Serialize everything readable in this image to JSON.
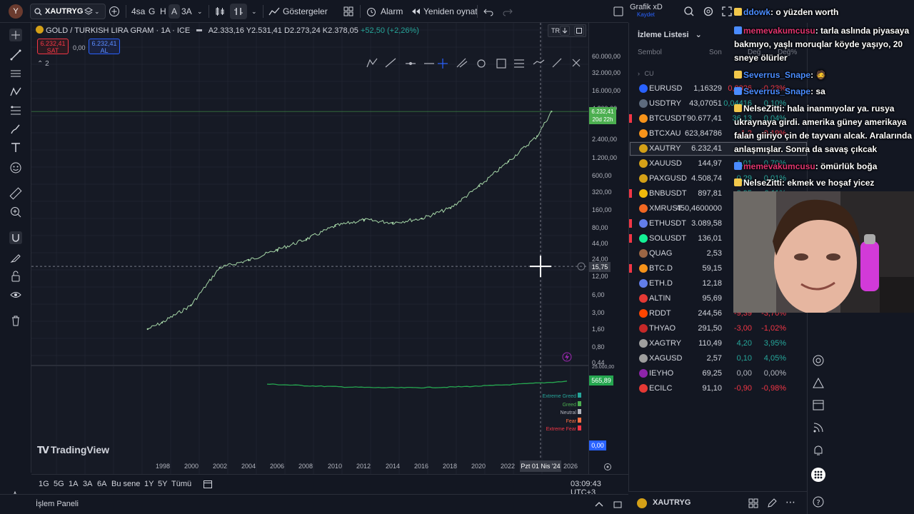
{
  "toolbar": {
    "avatar_letter": "Y",
    "symbol": "XAUTRYG",
    "interval_4h": "4sa",
    "interval_g": "G",
    "interval_h": "H",
    "interval_a": "A",
    "interval_3a": "3A",
    "indicators_label": "Göstergeler",
    "alarm_label": "Alarm",
    "replay_label": "Yeniden oynat",
    "layout_name": "Grafik xD",
    "layout_status": "Kaydet"
  },
  "chart": {
    "legend_title": "GOLD / TURKISH LIRA GRAM · 1A · ICE",
    "ohlc_a": "A2.333,16",
    "ohlc_y": "Y2.531,41",
    "ohlc_d": "D2.273,24",
    "ohlc_k": "K2.378,05",
    "ohlc_change": "+52,50 (+2,26%)",
    "sell_price": "6.232,41",
    "sell_label": "SAT",
    "spread": "0,00",
    "buy_price": "6.232,41",
    "buy_label": "AL",
    "indicators_count": "2",
    "currency": "TRY",
    "last_price": "6.232,41",
    "countdown": "20d 22h",
    "crosshair_price": "15,75",
    "crosshair_date": "Pzt 01 Nis '24",
    "osc_value": "565,89",
    "osc_zero": "0,00",
    "osc_labels": [
      "Extreme Greed",
      "Greed",
      "Neutral",
      "Fear",
      "Extreme Fear"
    ],
    "osc_colors": [
      "#26a69a",
      "#4caf50",
      "#b2b5be",
      "#ff7043",
      "#f23645"
    ],
    "brand": "TradingView",
    "price_ticks": [
      "60.000,00",
      "32.000,00",
      "16.000,00",
      "4.800,00",
      "2.400,00",
      "1.200,00",
      "600,00",
      "320,00",
      "160,00",
      "80,00",
      "44,00",
      "24,00",
      "12,00",
      "6,00",
      "3,00",
      "1,60",
      "0,80",
      "0,44",
      "25.000,00"
    ],
    "time_ticks": [
      "1998",
      "2000",
      "2002",
      "2004",
      "2006",
      "2008",
      "2010",
      "2012",
      "2014",
      "2016",
      "2018",
      "2020",
      "2022",
      "2026"
    ],
    "line_color": "#a5d6a7",
    "osc_color": "#26a650"
  },
  "chart_data": {
    "type": "line",
    "title": "GOLD / TURKISH LIRA GRAM · 1A · ICE",
    "x": [
      "1997",
      "1998",
      "2000",
      "2002",
      "2004",
      "2006",
      "2008",
      "2010",
      "2012",
      "2014",
      "2016",
      "2018",
      "2020",
      "2022",
      "2024",
      "2025"
    ],
    "y": [
      1.4,
      1.8,
      3.5,
      15,
      20,
      30,
      45,
      75,
      95,
      85,
      100,
      150,
      350,
      900,
      2400,
      6232.41
    ],
    "yscale": "log",
    "ylim": [
      0.44,
      60000
    ],
    "grid": true
  },
  "range_bar": {
    "ranges": [
      "1G",
      "5G",
      "1A",
      "3A",
      "6A",
      "Bu sene",
      "1Y",
      "5Y",
      "Tümü"
    ],
    "clock": "03:09:43 UTC+3"
  },
  "panel_bar": {
    "label": "İşlem Paneli"
  },
  "watchlist": {
    "title": "İzleme Listesi",
    "col_symbol": "Sembol",
    "col_last": "Son",
    "col_chg": "Değ",
    "col_chgp": "Değ%",
    "group": "CU",
    "rows": [
      {
        "name": "EURUSD",
        "last": "1,16329",
        "chg": "0,0026",
        "chgp": "-0,23%",
        "color": "#2962ff",
        "flag": false,
        "dir": "down"
      },
      {
        "name": "USDTRY",
        "last": "43,07051",
        "chg": "0,04416",
        "chgp": "0,10%",
        "color": "#5d6b7e",
        "flag": false,
        "dir": "up"
      },
      {
        "name": "BTCUSDT",
        "last": "90.677,41",
        "chg": "36,13",
        "chgp": "0,04%",
        "color": "#f7931a",
        "flag": true,
        "dir": "up"
      },
      {
        "name": "BTCXAU",
        "last": "623,84786",
        "chg": "-1,2",
        "chgp": "-0,19%",
        "color": "#f7931a",
        "flag": false,
        "dir": "down"
      },
      {
        "name": "XAUTRY",
        "last": "6.232,41",
        "chg": "",
        "chgp": "",
        "color": "#d4a017",
        "flag": false,
        "dir": "up",
        "selected": true
      },
      {
        "name": "XAUUSD",
        "last": "144,97",
        "chg": "1,01",
        "chgp": "0,70%",
        "color": "#d4a017",
        "flag": false,
        "dir": "up"
      },
      {
        "name": "PAXGUSD",
        "last": "4.508,74",
        "chg": "0,29",
        "chgp": "0,01%",
        "color": "#d4a017",
        "flag": false,
        "dir": "up"
      },
      {
        "name": "BNBUSDT",
        "last": "897,81",
        "chg": "0,95",
        "chgp": "0,11%",
        "color": "#f0b90b",
        "flag": true,
        "dir": "up"
      },
      {
        "name": "XMRUST",
        "last": "450,4600000",
        "chg": "-0",
        "chgp": "",
        "color": "#f26822",
        "flag": false,
        "dir": "down"
      },
      {
        "name": "ETHUSDT",
        "last": "3.089,58",
        "chg": "",
        "chgp": "",
        "color": "#627eea",
        "flag": true,
        "dir": "up"
      },
      {
        "name": "SOLUSDT",
        "last": "136,01",
        "chg": "",
        "chgp": "",
        "color": "#14f195",
        "flag": true,
        "dir": "up"
      },
      {
        "name": "QUAG",
        "last": "2,53",
        "chg": "",
        "chgp": "",
        "color": "#9c6644",
        "flag": false,
        "dir": "up"
      },
      {
        "name": "BTC.D",
        "last": "59,15",
        "chg": "",
        "chgp": "",
        "color": "#f7931a",
        "flag": true,
        "dir": "up"
      },
      {
        "name": "ETH.D",
        "last": "12,18",
        "chg": "",
        "chgp": "",
        "color": "#627eea",
        "flag": false,
        "dir": "up"
      },
      {
        "name": "ALTIN",
        "last": "95,69",
        "chg": "",
        "chgp": "",
        "color": "#e53935",
        "flag": false,
        "dir": "up"
      },
      {
        "name": "RDDT",
        "last": "244,56",
        "chg": "-9,39",
        "chgp": "-3,70%",
        "color": "#ff4500",
        "flag": false,
        "dir": "down"
      },
      {
        "name": "THYAO",
        "last": "291,50",
        "chg": "-3,00",
        "chgp": "-1,02%",
        "color": "#c62828",
        "flag": false,
        "dir": "down"
      },
      {
        "name": "XAGTRY",
        "last": "110,49",
        "chg": "4,20",
        "chgp": "3,95%",
        "color": "#9e9e9e",
        "flag": false,
        "dir": "up"
      },
      {
        "name": "XAGUSD",
        "last": "2,57",
        "chg": "0,10",
        "chgp": "4,05%",
        "color": "#9e9e9e",
        "flag": false,
        "dir": "up"
      },
      {
        "name": "IEYHO",
        "last": "69,25",
        "chg": "0,00",
        "chgp": "0,00%",
        "color": "#8e24aa",
        "flag": false,
        "dir": "flat"
      },
      {
        "name": "ECILC",
        "last": "91,10",
        "chg": "-0,90",
        "chgp": "-0,98%",
        "color": "#e53935",
        "flag": false,
        "dir": "down"
      }
    ],
    "footer_symbol": "XAUTRYG"
  },
  "chat": {
    "messages": [
      {
        "user": "ddowk",
        "user_color": "blue",
        "text": ": o yüzden worth"
      },
      {
        "user": "memevakumcusu",
        "user_color": "red",
        "text": ": tarla aslında piyasaya bakmıyo, yaşlı moruqlar köyde yaşıyo, 20 sneye ölürler"
      },
      {
        "user": "Severrus_Snape",
        "user_color": "blue",
        "text": ": 🧔"
      },
      {
        "user": "Severrus_Snape",
        "user_color": "blue",
        "text": ": sa"
      },
      {
        "user": "NelseZitti",
        "user_color": "white",
        "text": ": hala inanmıyolar ya. rusya ukraynaya girdi. amerika güney amerikaya falan giiriyo çin de tayvanı alcak. Aralarında anlaşmışlar. Sonra da savaş çıkcak"
      },
      {
        "user": "memevakumcusu",
        "user_color": "red",
        "text": ": ömürlük boğa"
      },
      {
        "user": "NelseZitti",
        "user_color": "white",
        "text": ": ekmek ve hoşaf yicez"
      }
    ]
  }
}
